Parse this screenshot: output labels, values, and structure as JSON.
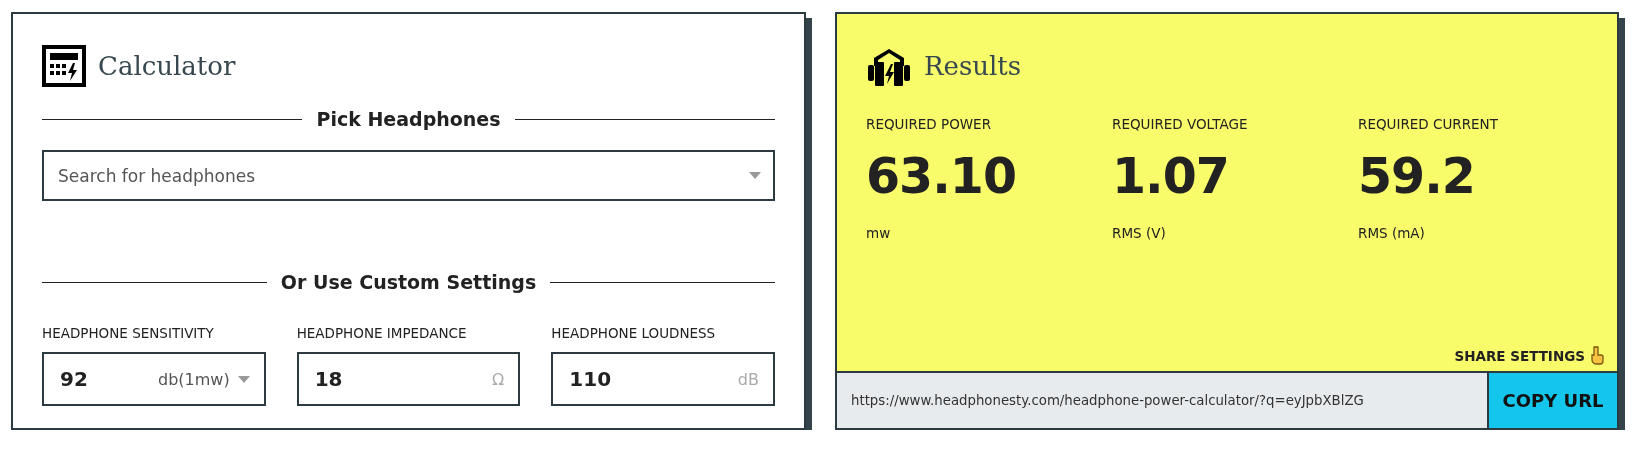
{
  "calculator": {
    "title": "Calculator",
    "pick_heading": "Pick Headphones",
    "search": {
      "placeholder": "Search for headphones"
    },
    "custom_heading": "Or Use Custom Settings",
    "settings": [
      {
        "label": "HEADPHONE SENSITIVITY",
        "value": "92",
        "unit": "db(1mw)",
        "kind": "select"
      },
      {
        "label": "HEADPHONE IMPEDANCE",
        "value": "18",
        "unit": "Ω",
        "kind": "unit"
      },
      {
        "label": "HEADPHONE LOUDNESS",
        "value": "110",
        "unit": "dB",
        "kind": "unit"
      }
    ]
  },
  "results": {
    "title": "Results",
    "metrics": [
      {
        "label": "REQUIRED POWER",
        "value": "63.10",
        "unit": "mw"
      },
      {
        "label": "REQUIRED VOLTAGE",
        "value": "1.07",
        "unit": "RMS (V)"
      },
      {
        "label": "REQUIRED CURRENT",
        "value": "59.2",
        "unit": "RMS (mA)"
      }
    ],
    "share_label": "SHARE SETTINGS",
    "share_url": "https://www.headphonesty.com/headphone-power-calculator/?q=eyJpbXBlZG",
    "copy_button": "COPY URL"
  }
}
